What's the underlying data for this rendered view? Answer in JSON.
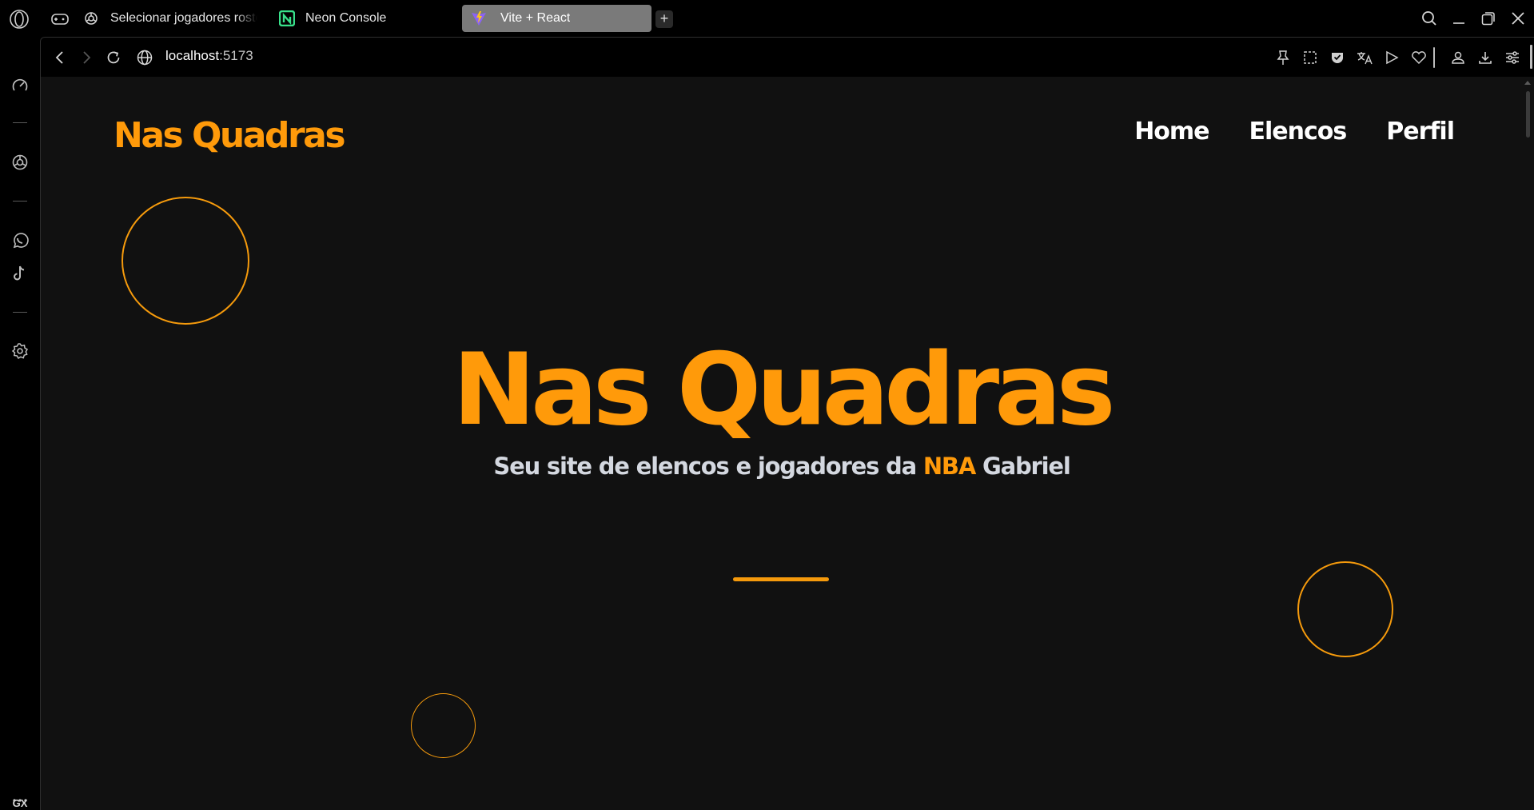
{
  "browser": {
    "tabs": [
      {
        "label": "Selecionar jogadores roste",
        "icon": "chatgpt-icon",
        "active": false
      },
      {
        "label": "Neon Console",
        "icon": "neon-icon",
        "active": false
      },
      {
        "label": "Vite + React",
        "icon": "vite-icon",
        "active": true
      }
    ],
    "new_tab_label": "+",
    "address": {
      "host": "localhost",
      "port": ":5173"
    },
    "sidebar_bottom_label": "GX"
  },
  "site": {
    "brand": "Nas Quadras",
    "nav": [
      "Home",
      "Elencos",
      "Perfil"
    ],
    "hero": {
      "title": "Nas Quadras",
      "subtitle_before": "Seu site de elencos e jogadores da ",
      "subtitle_accent": "NBA",
      "subtitle_after": " Gabriel"
    }
  },
  "colors": {
    "accent": "#ff9a0a",
    "page_background": "#111111",
    "chrome_background": "#000000",
    "active_tab": "#7a7a7a"
  }
}
